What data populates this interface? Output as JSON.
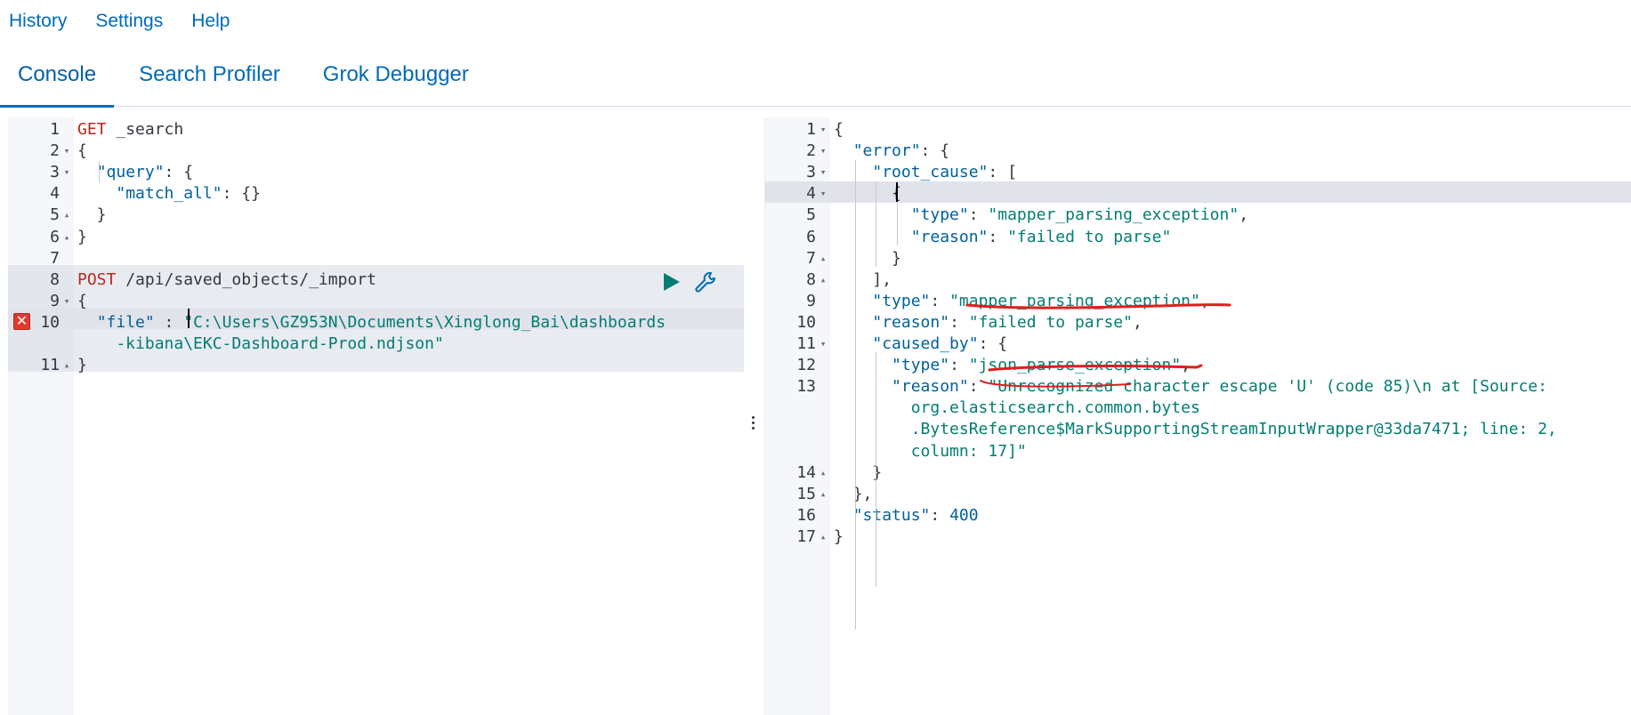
{
  "top_menu": {
    "history": "History",
    "settings": "Settings",
    "help": "Help"
  },
  "tabs": [
    {
      "label": "Console",
      "active": true
    },
    {
      "label": "Search Profiler",
      "active": false
    },
    {
      "label": "Grok Debugger",
      "active": false
    }
  ],
  "colors": {
    "accent": "#006bb8",
    "error": "#dd3b2e",
    "play": "#017d73",
    "annotation": "#e11d1d"
  },
  "request": {
    "line_numbers": [
      "1",
      "2",
      "3",
      "4",
      "5",
      "6",
      "7",
      "8",
      "9",
      "10",
      "",
      "11"
    ],
    "lines": [
      [
        {
          "t": "GET",
          "c": "k-method"
        },
        {
          "t": " _search",
          "c": "k-url"
        }
      ],
      [
        {
          "t": "{",
          "c": "k-punc"
        }
      ],
      [
        {
          "t": "  ",
          "c": "k-punc"
        },
        {
          "t": "\"query\"",
          "c": "k-key"
        },
        {
          "t": ": {",
          "c": "k-punc"
        }
      ],
      [
        {
          "t": "    ",
          "c": "k-punc"
        },
        {
          "t": "\"match_all\"",
          "c": "k-key"
        },
        {
          "t": ": {}",
          "c": "k-punc"
        }
      ],
      [
        {
          "t": "  }",
          "c": "k-punc"
        }
      ],
      [
        {
          "t": "}",
          "c": "k-punc"
        }
      ],
      [
        {
          "t": "",
          "c": "k-punc"
        }
      ],
      [
        {
          "t": "POST",
          "c": "k-method"
        },
        {
          "t": " /api/saved_objects/_import",
          "c": "k-url"
        }
      ],
      [
        {
          "t": "{",
          "c": "k-punc"
        }
      ],
      [
        {
          "t": "  ",
          "c": "k-punc"
        },
        {
          "t": "\"file\"",
          "c": "k-key"
        },
        {
          "t": " : ",
          "c": "k-punc"
        },
        {
          "t": "\"C:\\Users\\GZ953N\\Documents\\Xinglong_Bai\\dashboards",
          "c": "k-str"
        }
      ],
      [
        {
          "t": "    -kibana\\EKC-Dashboard-Prod.ndjson\"",
          "c": "k-str"
        }
      ],
      [
        {
          "t": "}",
          "c": "k-punc"
        }
      ]
    ]
  },
  "response": {
    "line_numbers": [
      "1",
      "2",
      "3",
      "4",
      "5",
      "6",
      "7",
      "8",
      "9",
      "10",
      "11",
      "12",
      "13",
      "",
      "",
      "",
      "14",
      "15",
      "16",
      "17"
    ],
    "lines": [
      [
        {
          "t": "{",
          "c": "k-punc"
        }
      ],
      [
        {
          "t": "  ",
          "c": "k-punc"
        },
        {
          "t": "\"error\"",
          "c": "k-key"
        },
        {
          "t": ": {",
          "c": "k-punc"
        }
      ],
      [
        {
          "t": "    ",
          "c": "k-punc"
        },
        {
          "t": "\"root_cause\"",
          "c": "k-key"
        },
        {
          "t": ": [",
          "c": "k-punc"
        }
      ],
      [
        {
          "t": "      {",
          "c": "k-punc"
        }
      ],
      [
        {
          "t": "        ",
          "c": "k-punc"
        },
        {
          "t": "\"type\"",
          "c": "k-key"
        },
        {
          "t": ": ",
          "c": "k-punc"
        },
        {
          "t": "\"mapper_parsing_exception\"",
          "c": "k-str"
        },
        {
          "t": ",",
          "c": "k-punc"
        }
      ],
      [
        {
          "t": "        ",
          "c": "k-punc"
        },
        {
          "t": "\"reason\"",
          "c": "k-key"
        },
        {
          "t": ": ",
          "c": "k-punc"
        },
        {
          "t": "\"failed to parse\"",
          "c": "k-str"
        }
      ],
      [
        {
          "t": "      }",
          "c": "k-punc"
        }
      ],
      [
        {
          "t": "    ],",
          "c": "k-punc"
        }
      ],
      [
        {
          "t": "    ",
          "c": "k-punc"
        },
        {
          "t": "\"type\"",
          "c": "k-key"
        },
        {
          "t": ": ",
          "c": "k-punc"
        },
        {
          "t": "\"mapper_parsing_exception\"",
          "c": "k-str"
        },
        {
          "t": ",",
          "c": "k-punc"
        }
      ],
      [
        {
          "t": "    ",
          "c": "k-punc"
        },
        {
          "t": "\"reason\"",
          "c": "k-key"
        },
        {
          "t": ": ",
          "c": "k-punc"
        },
        {
          "t": "\"failed to parse\"",
          "c": "k-str"
        },
        {
          "t": ",",
          "c": "k-punc"
        }
      ],
      [
        {
          "t": "    ",
          "c": "k-punc"
        },
        {
          "t": "\"caused_by\"",
          "c": "k-key"
        },
        {
          "t": ": {",
          "c": "k-punc"
        }
      ],
      [
        {
          "t": "      ",
          "c": "k-punc"
        },
        {
          "t": "\"type\"",
          "c": "k-key"
        },
        {
          "t": ": ",
          "c": "k-punc"
        },
        {
          "t": "\"json_parse_exception\"",
          "c": "k-str"
        },
        {
          "t": ",",
          "c": "k-punc"
        }
      ],
      [
        {
          "t": "      ",
          "c": "k-punc"
        },
        {
          "t": "\"reason\"",
          "c": "k-key"
        },
        {
          "t": ": ",
          "c": "k-punc"
        },
        {
          "t": "\"Unrecognized character escape 'U' (code 85)\\n at [Source:",
          "c": "k-str"
        }
      ],
      [
        {
          "t": "        org.elasticsearch.common.bytes",
          "c": "k-str"
        }
      ],
      [
        {
          "t": "        .BytesReference$MarkSupportingStreamInputWrapper@33da7471; line: 2,",
          "c": "k-str"
        }
      ],
      [
        {
          "t": "        column: 17]\"",
          "c": "k-str"
        }
      ],
      [
        {
          "t": "    }",
          "c": "k-punc"
        }
      ],
      [
        {
          "t": "  },",
          "c": "k-punc"
        }
      ],
      [
        {
          "t": "  ",
          "c": "k-punc"
        },
        {
          "t": "\"status\"",
          "c": "k-key"
        },
        {
          "t": ": ",
          "c": "k-punc"
        },
        {
          "t": "400",
          "c": "k-num"
        }
      ],
      [
        {
          "t": "}",
          "c": "k-punc"
        }
      ]
    ]
  }
}
